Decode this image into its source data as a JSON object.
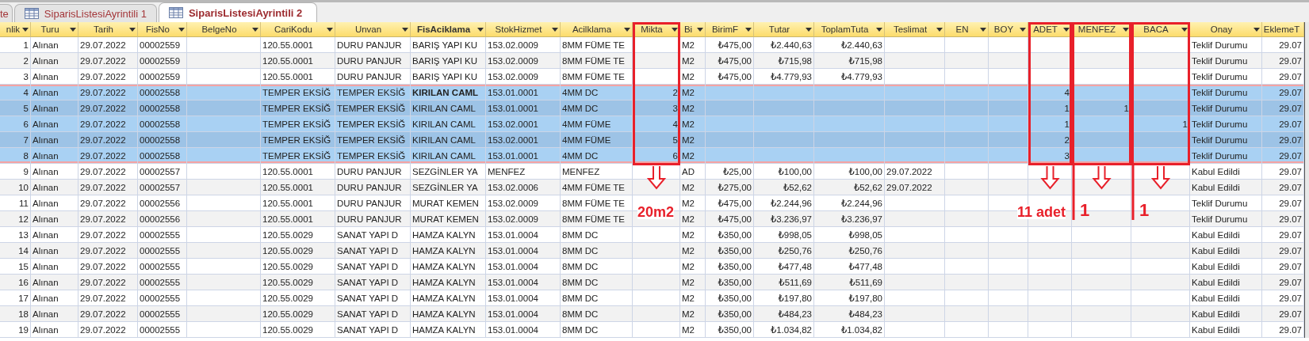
{
  "tabs": [
    {
      "label": "te",
      "selected": false,
      "icon": false
    },
    {
      "label": "SiparisListesiAyrintili 1",
      "selected": false,
      "icon": true
    },
    {
      "label": "SiparisListesiAyrintili 2",
      "selected": true,
      "icon": true
    }
  ],
  "table": {
    "columns": [
      {
        "label": "nlik",
        "kind": "number"
      },
      {
        "label": "Turu",
        "kind": "text"
      },
      {
        "label": "Tarih",
        "kind": "text"
      },
      {
        "label": "FisNo",
        "kind": "text"
      },
      {
        "label": "BelgeNo",
        "kind": "text"
      },
      {
        "label": "CariKodu",
        "kind": "text"
      },
      {
        "label": "Unvan",
        "kind": "text"
      },
      {
        "label": "FisAciklama",
        "kind": "text",
        "focused": true
      },
      {
        "label": "StokHizmet",
        "kind": "text"
      },
      {
        "label": "Acilklama",
        "kind": "text"
      },
      {
        "label": "Mikta",
        "kind": "number",
        "highlighted": true,
        "note": "20m2",
        "ruled": false
      },
      {
        "label": "Bi",
        "kind": "text"
      },
      {
        "label": "BirimF",
        "kind": "number"
      },
      {
        "label": "Tutar",
        "kind": "number"
      },
      {
        "label": "ToplamTuta",
        "kind": "number"
      },
      {
        "label": "Teslimat",
        "kind": "text"
      },
      {
        "label": "EN",
        "kind": "number"
      },
      {
        "label": "BOY",
        "kind": "number"
      },
      {
        "label": "ADET",
        "kind": "number",
        "highlighted": true,
        "note": "11 adet",
        "ruled": false
      },
      {
        "label": "MENFEZ",
        "kind": "number",
        "highlighted": true,
        "note": "1",
        "ruled": true
      },
      {
        "label": "BACA",
        "kind": "number",
        "highlighted": true,
        "note": "1",
        "ruled": true
      },
      {
        "label": "Onay",
        "kind": "text"
      },
      {
        "label": "EklemeT",
        "kind": "number"
      }
    ],
    "rows": [
      {
        "selected": false,
        "current": false,
        "cells": [
          "1",
          "Alınan",
          "29.07.2022",
          "00002559",
          null,
          "120.55.0001",
          "DURU PANJUR",
          "BARIŞ YAPI KU",
          "153.02.0009",
          "8MM FÜME TE",
          null,
          "M2",
          "₺475,00",
          "₺2.440,63",
          "₺2.440,63",
          null,
          null,
          null,
          null,
          null,
          null,
          "Teklif Durumu",
          "29.07"
        ]
      },
      {
        "selected": false,
        "current": false,
        "cells": [
          "2",
          "Alınan",
          "29.07.2022",
          "00002559",
          null,
          "120.55.0001",
          "DURU PANJUR",
          "BARIŞ YAPI KU",
          "153.02.0009",
          "8MM FÜME TE",
          null,
          "M2",
          "₺475,00",
          "₺715,98",
          "₺715,98",
          null,
          null,
          null,
          null,
          null,
          null,
          "Teklif Durumu",
          "29.07"
        ]
      },
      {
        "selected": false,
        "current": false,
        "cells": [
          "3",
          "Alınan",
          "29.07.2022",
          "00002559",
          null,
          "120.55.0001",
          "DURU PANJUR",
          "BARIŞ YAPI KU",
          "153.02.0009",
          "8MM FÜME TE",
          null,
          "M2",
          "₺475,00",
          "₺4.779,93",
          "₺4.779,93",
          null,
          null,
          null,
          null,
          null,
          null,
          "Teklif Durumu",
          "29.07"
        ]
      },
      {
        "selected": true,
        "current": true,
        "cells": [
          "4",
          "Alınan",
          "29.07.2022",
          "00002558",
          null,
          "TEMPER EKSİĞ",
          "TEMPER EKSİĞ",
          "KIRILAN CAML",
          "153.01.0001",
          "4MM DC",
          "2",
          "M2",
          null,
          null,
          null,
          null,
          null,
          null,
          "4",
          null,
          null,
          "Teklif Durumu",
          "29.07"
        ]
      },
      {
        "selected": true,
        "current": false,
        "cells": [
          "5",
          "Alınan",
          "29.07.2022",
          "00002558",
          null,
          "TEMPER EKSİĞ",
          "TEMPER EKSİĞ",
          "KIRILAN CAML",
          "153.01.0001",
          "4MM DC",
          "3",
          "M2",
          null,
          null,
          null,
          null,
          null,
          null,
          "1",
          "1",
          null,
          "Teklif Durumu",
          "29.07"
        ]
      },
      {
        "selected": true,
        "current": false,
        "cells": [
          "6",
          "Alınan",
          "29.07.2022",
          "00002558",
          null,
          "TEMPER EKSİĞ",
          "TEMPER EKSİĞ",
          "KIRILAN CAML",
          "153.02.0001",
          "4MM FÜME",
          "4",
          "M2",
          null,
          null,
          null,
          null,
          null,
          null,
          "1",
          null,
          "1",
          "Teklif Durumu",
          "29.07"
        ]
      },
      {
        "selected": true,
        "current": false,
        "cells": [
          "7",
          "Alınan",
          "29.07.2022",
          "00002558",
          null,
          "TEMPER EKSİĞ",
          "TEMPER EKSİĞ",
          "KIRILAN CAML",
          "153.02.0001",
          "4MM FÜME",
          "5",
          "M2",
          null,
          null,
          null,
          null,
          null,
          null,
          "2",
          null,
          null,
          "Teklif Durumu",
          "29.07"
        ]
      },
      {
        "selected": true,
        "current": false,
        "cells": [
          "8",
          "Alınan",
          "29.07.2022",
          "00002558",
          null,
          "TEMPER EKSİĞ",
          "TEMPER EKSİĞ",
          "KIRILAN CAML",
          "153.01.0001",
          "4MM DC",
          "6",
          "M2",
          null,
          null,
          null,
          null,
          null,
          null,
          "3",
          null,
          null,
          "Teklif Durumu",
          "29.07"
        ]
      },
      {
        "selected": false,
        "current": false,
        "cells": [
          "9",
          "Alınan",
          "29.07.2022",
          "00002557",
          null,
          "120.55.0001",
          "DURU PANJUR",
          "SEZGİNLER YA",
          "MENFEZ",
          "MENFEZ",
          null,
          "AD",
          "₺25,00",
          "₺100,00",
          "₺100,00",
          "29.07.2022",
          null,
          null,
          null,
          null,
          null,
          "Kabul Edildi",
          "29.07"
        ]
      },
      {
        "selected": false,
        "current": false,
        "cells": [
          "10",
          "Alınan",
          "29.07.2022",
          "00002557",
          null,
          "120.55.0001",
          "DURU PANJUR",
          "SEZGİNLER YA",
          "153.02.0006",
          "4MM FÜME TE",
          null,
          "M2",
          "₺275,00",
          "₺52,62",
          "₺52,62",
          "29.07.2022",
          null,
          null,
          null,
          null,
          null,
          "Kabul Edildi",
          "29.07"
        ]
      },
      {
        "selected": false,
        "current": false,
        "cells": [
          "11",
          "Alınan",
          "29.07.2022",
          "00002556",
          null,
          "120.55.0001",
          "DURU PANJUR",
          "MURAT KEMEN",
          "153.02.0009",
          "8MM FÜME TE",
          null,
          "M2",
          "₺475,00",
          "₺2.244,96",
          "₺2.244,96",
          null,
          null,
          null,
          null,
          null,
          null,
          "Teklif Durumu",
          "29.07"
        ]
      },
      {
        "selected": false,
        "current": false,
        "cells": [
          "12",
          "Alınan",
          "29.07.2022",
          "00002556",
          null,
          "120.55.0001",
          "DURU PANJUR",
          "MURAT KEMEN",
          "153.02.0009",
          "8MM FÜME TE",
          null,
          "M2",
          "₺475,00",
          "₺3.236,97",
          "₺3.236,97",
          null,
          null,
          null,
          null,
          null,
          null,
          "Teklif Durumu",
          "29.07"
        ]
      },
      {
        "selected": false,
        "current": false,
        "cells": [
          "13",
          "Alınan",
          "29.07.2022",
          "00002555",
          null,
          "120.55.0029",
          "SANAT YAPI D",
          "HAMZA KALYN",
          "153.01.0004",
          "8MM DC",
          null,
          "M2",
          "₺350,00",
          "₺998,05",
          "₺998,05",
          null,
          null,
          null,
          null,
          null,
          null,
          "Kabul Edildi",
          "29.07"
        ]
      },
      {
        "selected": false,
        "current": false,
        "cells": [
          "14",
          "Alınan",
          "29.07.2022",
          "00002555",
          null,
          "120.55.0029",
          "SANAT YAPI D",
          "HAMZA KALYN",
          "153.01.0004",
          "8MM DC",
          null,
          "M2",
          "₺350,00",
          "₺250,76",
          "₺250,76",
          null,
          null,
          null,
          null,
          null,
          null,
          "Kabul Edildi",
          "29.07"
        ]
      },
      {
        "selected": false,
        "current": false,
        "cells": [
          "15",
          "Alınan",
          "29.07.2022",
          "00002555",
          null,
          "120.55.0029",
          "SANAT YAPI D",
          "HAMZA KALYN",
          "153.01.0004",
          "8MM DC",
          null,
          "M2",
          "₺350,00",
          "₺477,48",
          "₺477,48",
          null,
          null,
          null,
          null,
          null,
          null,
          "Kabul Edildi",
          "29.07"
        ]
      },
      {
        "selected": false,
        "current": false,
        "cells": [
          "16",
          "Alınan",
          "29.07.2022",
          "00002555",
          null,
          "120.55.0029",
          "SANAT YAPI D",
          "HAMZA KALYN",
          "153.01.0004",
          "8MM DC",
          null,
          "M2",
          "₺350,00",
          "₺511,69",
          "₺511,69",
          null,
          null,
          null,
          null,
          null,
          null,
          "Kabul Edildi",
          "29.07"
        ]
      },
      {
        "selected": false,
        "current": false,
        "cells": [
          "17",
          "Alınan",
          "29.07.2022",
          "00002555",
          null,
          "120.55.0029",
          "SANAT YAPI D",
          "HAMZA KALYN",
          "153.01.0004",
          "8MM DC",
          null,
          "M2",
          "₺350,00",
          "₺197,80",
          "₺197,80",
          null,
          null,
          null,
          null,
          null,
          null,
          "Kabul Edildi",
          "29.07"
        ]
      },
      {
        "selected": false,
        "current": false,
        "cells": [
          "18",
          "Alınan",
          "29.07.2022",
          "00002555",
          null,
          "120.55.0029",
          "SANAT YAPI D",
          "HAMZA KALYN",
          "153.01.0004",
          "8MM DC",
          null,
          "M2",
          "₺350,00",
          "₺484,23",
          "₺484,23",
          null,
          null,
          null,
          null,
          null,
          null,
          "Kabul Edildi",
          "29.07"
        ]
      },
      {
        "selected": false,
        "current": false,
        "cells": [
          "19",
          "Alınan",
          "29.07.2022",
          "00002555",
          null,
          "120.55.0029",
          "SANAT YAPI D",
          "HAMZA KALYN",
          "153.01.0004",
          "8MM DC",
          null,
          "M2",
          "₺350,00",
          "₺1.034,82",
          "₺1.034,82",
          null,
          null,
          null,
          null,
          null,
          null,
          "Kabul Edildi",
          "29.07"
        ]
      }
    ]
  }
}
